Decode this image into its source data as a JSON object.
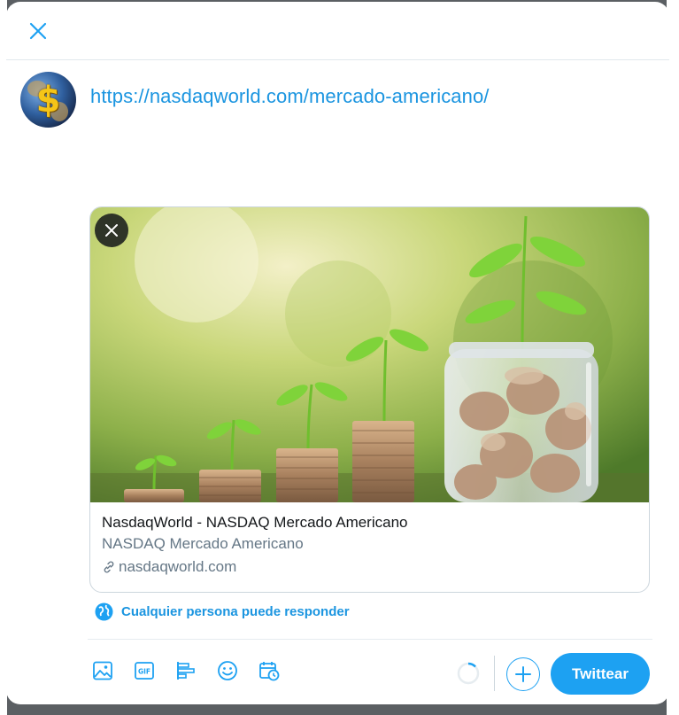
{
  "modal": {
    "close_label": "Close"
  },
  "composer": {
    "avatar_icon": "dollar-globe-avatar",
    "text": "https://nasdaqworld.com/mercado-americano/"
  },
  "card": {
    "title": "NasdaqWorld - NASDAQ Mercado Americano",
    "description": "NASDAQ Mercado Americano",
    "domain": "nasdaqworld.com",
    "image_subject": "coin stacks with growing plants"
  },
  "reply_setting": {
    "label": "Cualquier persona puede responder",
    "icon": "globe-icon"
  },
  "toolbar": {
    "items": [
      "image-icon",
      "gif-icon",
      "poll-icon",
      "emoji-icon",
      "schedule-icon"
    ],
    "tweet_label": "Twittear"
  },
  "colors": {
    "accent": "#1da1f2",
    "link": "#1b95e0",
    "muted": "#657786"
  }
}
